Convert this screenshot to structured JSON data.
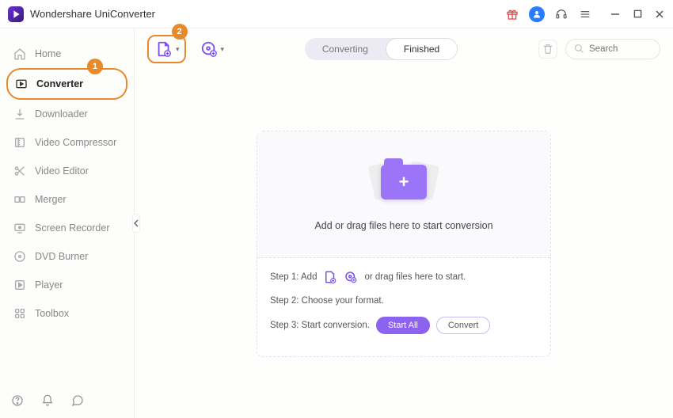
{
  "app": {
    "title": "Wondershare UniConverter"
  },
  "sidebar": {
    "items": [
      {
        "label": "Home"
      },
      {
        "label": "Converter"
      },
      {
        "label": "Downloader"
      },
      {
        "label": "Video Compressor"
      },
      {
        "label": "Video Editor"
      },
      {
        "label": "Merger"
      },
      {
        "label": "Screen Recorder"
      },
      {
        "label": "DVD Burner"
      },
      {
        "label": "Player"
      },
      {
        "label": "Toolbox"
      }
    ]
  },
  "callouts": {
    "n1": "1",
    "n2": "2"
  },
  "tabs": {
    "converting": "Converting",
    "finished": "Finished"
  },
  "search": {
    "placeholder": "Search"
  },
  "drop": {
    "headline": "Add or drag files here to start conversion",
    "step1_prefix": "Step 1: Add",
    "step1_suffix": "or drag files here to start.",
    "step2": "Step 2: Choose your format.",
    "step3_prefix": "Step 3: Start conversion.",
    "start_all": "Start All",
    "convert": "Convert"
  }
}
